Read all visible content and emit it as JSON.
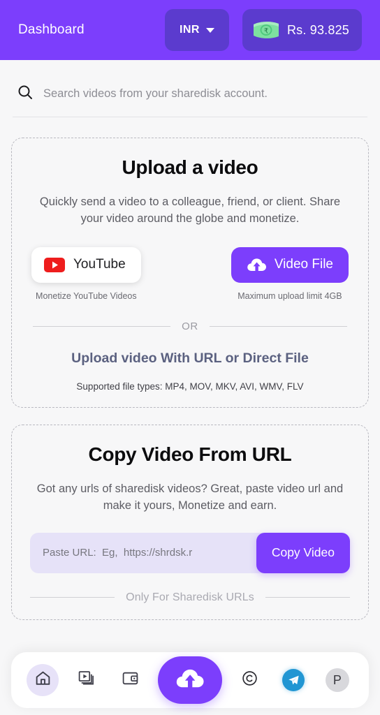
{
  "header": {
    "title": "Dashboard",
    "currency": {
      "code": "INR",
      "icon": "chevron-down-icon"
    },
    "balance": {
      "amount": "Rs. 93.825",
      "icon": "money-banknote-icon"
    },
    "bg_color": "#7C3EFC",
    "chip_color": "#5B3BCE"
  },
  "search": {
    "placeholder": "Search videos from your sharedisk account.",
    "value": "",
    "icon": "search-icon"
  },
  "upload_card": {
    "title": "Upload a video",
    "subtitle": "Quickly send a video to a colleague, friend, or client. Share your video around the globe and monetize.",
    "youtube_button": {
      "label": "YouTube",
      "icon": "youtube-icon",
      "caption": "Monetize YouTube Videos"
    },
    "videofile_button": {
      "label": "Video File",
      "icon": "cloud-upload-icon",
      "caption": "Maximum upload limit 4GB"
    },
    "divider_label": "OR",
    "url_link": "Upload video With URL or Direct File",
    "file_types": "Supported file types: MP4, MOV, MKV, AVI, WMV, FLV"
  },
  "copy_card": {
    "title": "Copy Video From URL",
    "subtitle": "Got any urls of sharedisk videos? Great, paste video url and make it yours, Monetize and earn.",
    "url_placeholder": "Paste URL:  Eg,  https://shrdsk.r",
    "url_value": "",
    "copy_button": "Copy Video",
    "divider_label": "Only For Sharedisk URLs"
  },
  "bottom_nav": {
    "items": [
      {
        "name": "home",
        "icon": "home-icon",
        "active": true
      },
      {
        "name": "videos",
        "icon": "video-library-icon",
        "active": false
      },
      {
        "name": "wallet",
        "icon": "wallet-icon",
        "active": false
      },
      {
        "name": "upload",
        "icon": "cloud-upload-icon",
        "active": false
      },
      {
        "name": "copyright",
        "icon": "copyright-icon",
        "active": false
      },
      {
        "name": "telegram",
        "icon": "telegram-icon",
        "active": false
      },
      {
        "name": "profile",
        "icon": "avatar-icon",
        "active": false
      }
    ],
    "avatar_initial": "P",
    "accent_color": "#7C3EFC"
  }
}
